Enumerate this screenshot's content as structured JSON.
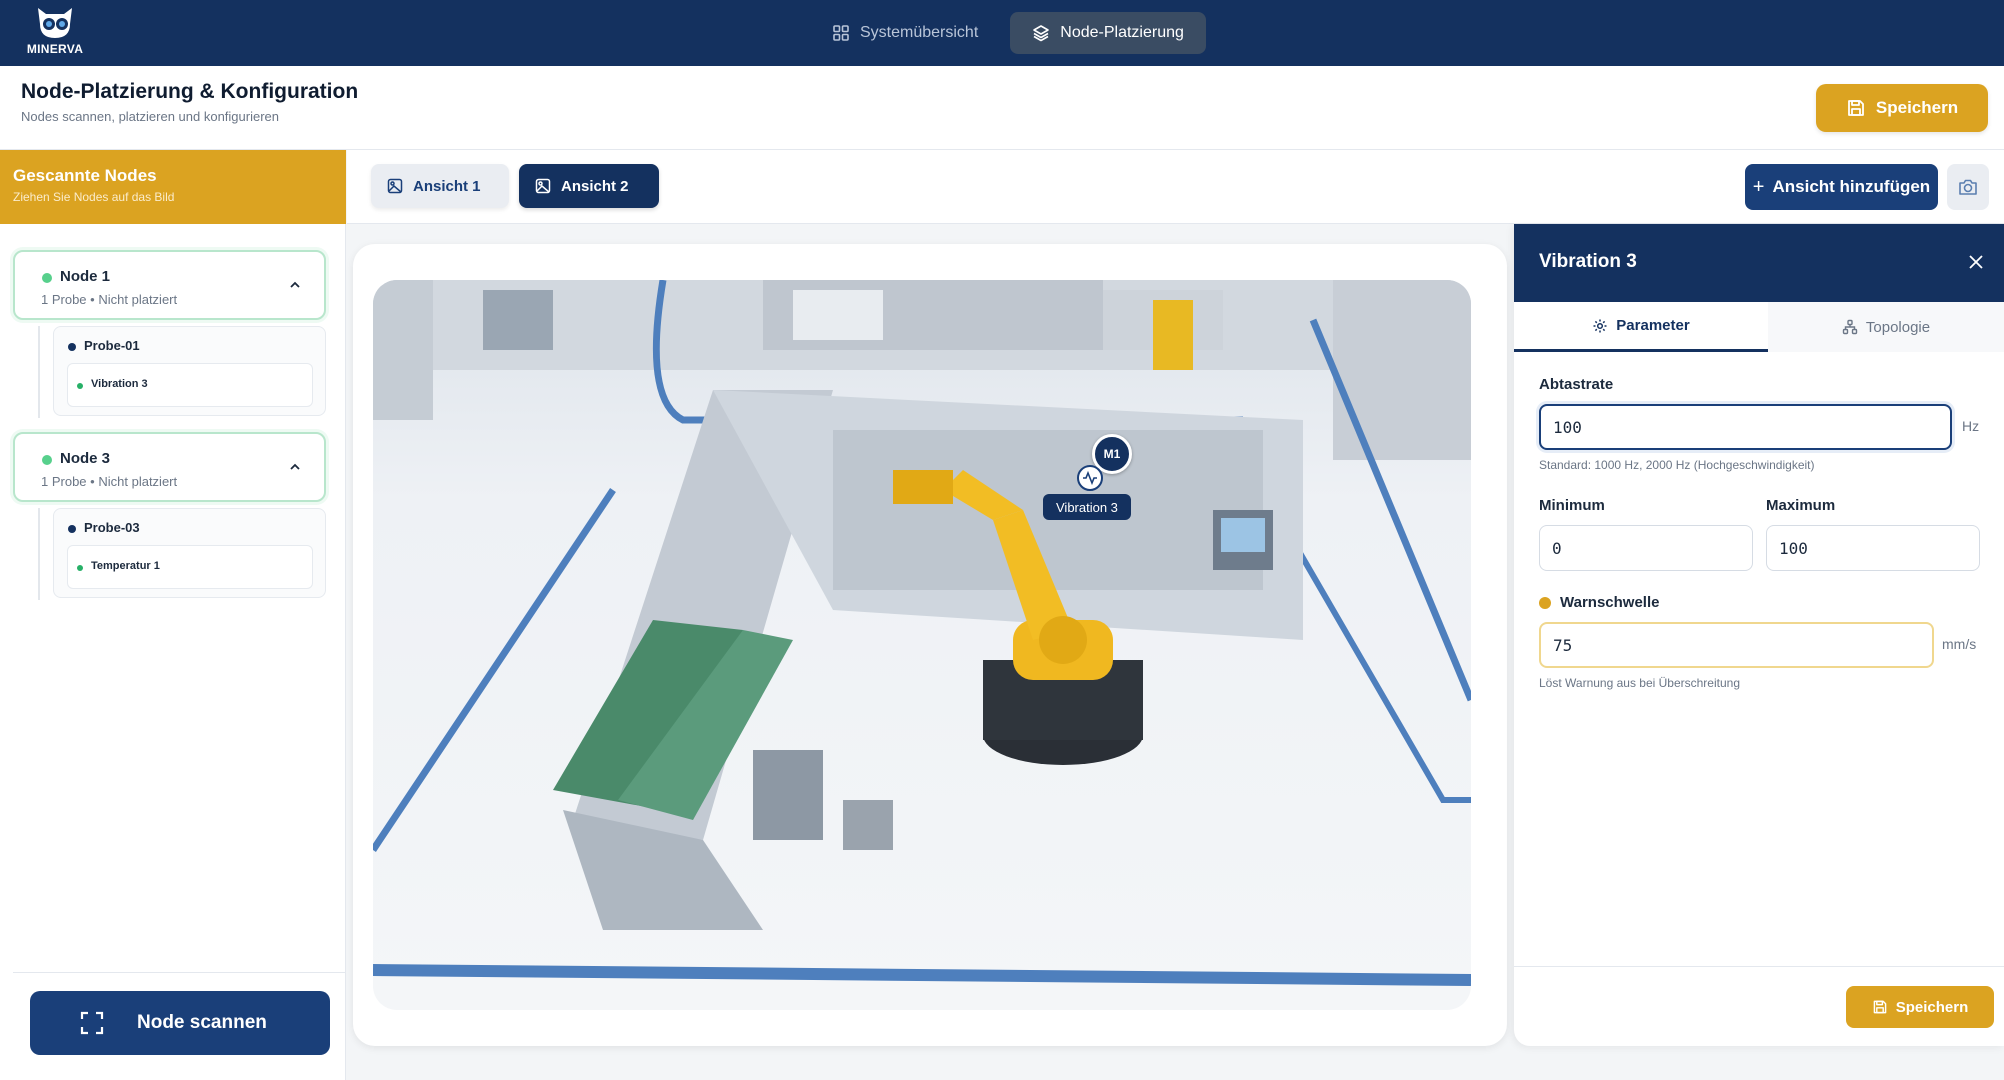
{
  "app": {
    "brand": "MINERVA"
  },
  "nav": {
    "tabs": [
      {
        "label": "Systemübersicht",
        "icon": "grid-icon"
      },
      {
        "label": "Node-Platzierung",
        "icon": "layers-icon",
        "active": true
      }
    ]
  },
  "header": {
    "title": "Node-Platzierung & Konfiguration",
    "subtitle": "Nodes scannen, platzieren und konfigurieren",
    "save_label": "Speichern"
  },
  "sidebar": {
    "title": "Gescannte Nodes",
    "subtitle": "Ziehen Sie Nodes auf das Bild",
    "nodes": [
      {
        "name": "Node 1",
        "probes_count": "1 Probe",
        "status": "Nicht platziert",
        "probe": "Probe-01",
        "sensor": "Vibration 3"
      },
      {
        "name": "Node 3",
        "probes_count": "1 Probe",
        "status": "Nicht platziert",
        "probe": "Probe-03",
        "sensor": "Temperatur 1"
      }
    ],
    "separator": "•",
    "scan_label": "Node scannen"
  },
  "views": {
    "tabs": [
      {
        "label": "Ansicht 1"
      },
      {
        "label": "Ansicht 2",
        "active": true
      }
    ],
    "add_label": "Ansicht hinzufügen"
  },
  "canvas": {
    "markers": {
      "machine": "M1",
      "sensor_label": "Vibration 3"
    }
  },
  "panel": {
    "title": "Vibration 3",
    "tabs": [
      {
        "label": "Parameter",
        "active": true
      },
      {
        "label": "Topologie"
      }
    ],
    "sample_rate": {
      "label": "Abtastrate",
      "value": "100",
      "unit": "Hz",
      "hint": "Standard: 1000 Hz, 2000 Hz (Hochgeschwindigkeit)"
    },
    "minimum": {
      "label": "Minimum",
      "value": "0"
    },
    "maximum": {
      "label": "Maximum",
      "value": "100"
    },
    "warning": {
      "label": "Warnschwelle",
      "value": "75",
      "unit": "mm/s",
      "hint": "Löst Warnung aus bei Überschreitung"
    },
    "save_label": "Speichern"
  },
  "colors": {
    "navy": "#14315f",
    "accent": "#dba321",
    "status_ok": "#57d08c"
  }
}
